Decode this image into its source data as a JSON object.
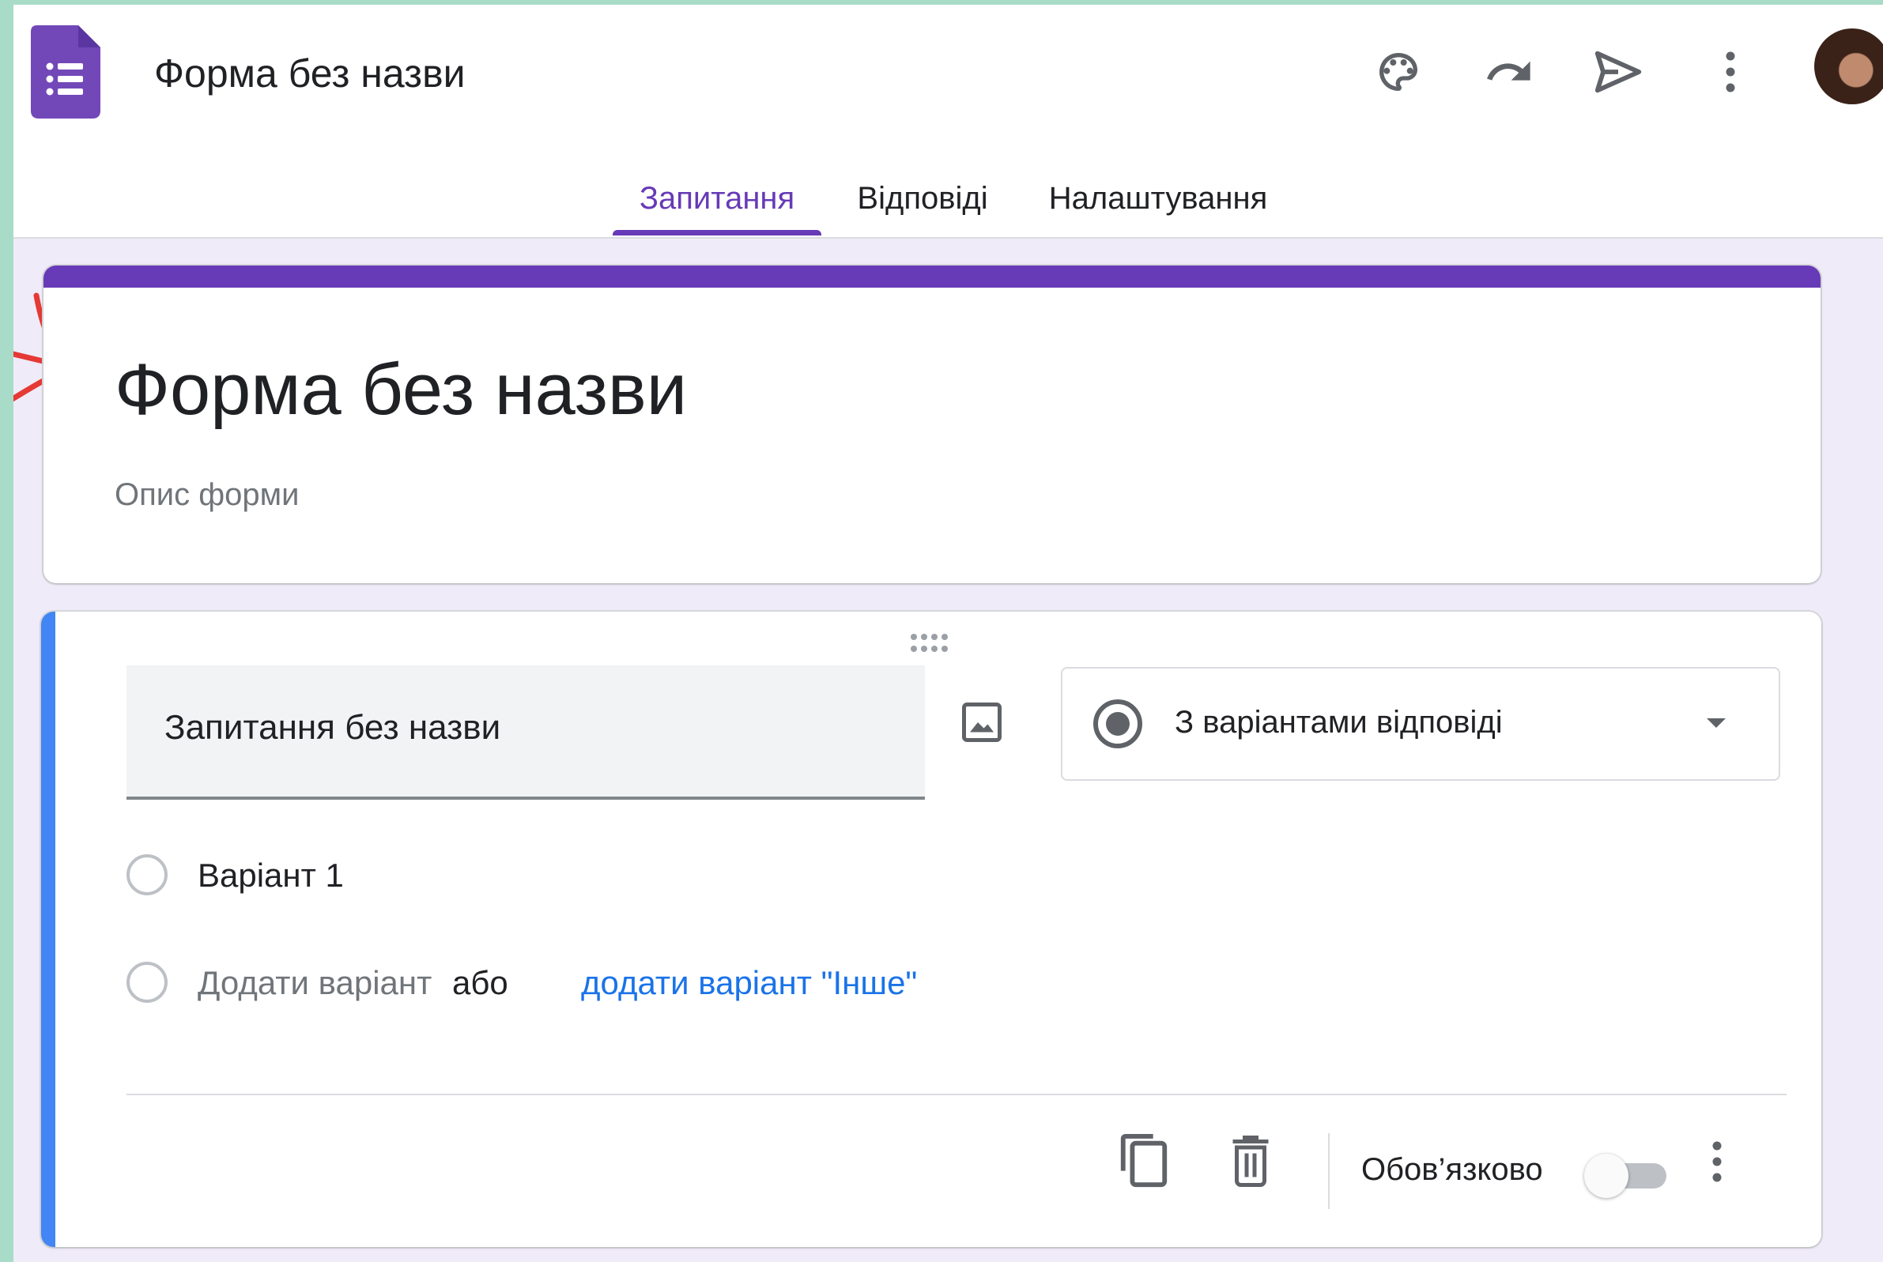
{
  "app": {
    "doc_title": "Форма без назви",
    "icons": [
      "forms-logo-icon",
      "palette-icon",
      "undo-icon",
      "send-icon",
      "more-vert-icon"
    ],
    "accent_color": "#673ab7"
  },
  "tabs": [
    {
      "label": "Запитання",
      "active": true
    },
    {
      "label": "Відповіді",
      "active": false
    },
    {
      "label": "Налаштування",
      "active": false
    }
  ],
  "form": {
    "title": "Форма без назви",
    "description_placeholder": "Опис форми"
  },
  "question": {
    "title_placeholder": "Запитання без назви",
    "type_label": "З варіантами відповіді",
    "options": [
      {
        "label": "Варіант 1"
      }
    ],
    "add_option_label": "Додати варіант",
    "or_label": "або",
    "add_other_label": "додати варіант \"Інше\"",
    "required_label": "Обов’язково",
    "required": false,
    "active_color": "#4285f4"
  }
}
